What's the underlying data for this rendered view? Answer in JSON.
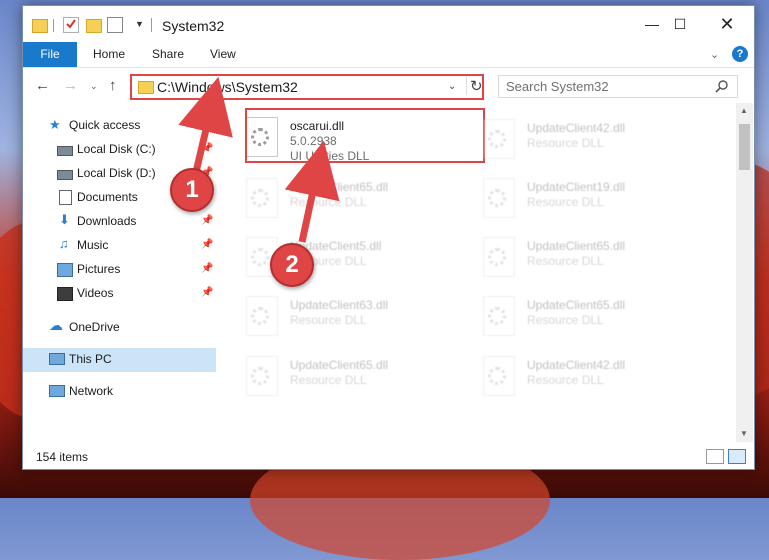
{
  "window": {
    "title": "System32"
  },
  "ribbon": {
    "tabs": [
      "File",
      "Home",
      "Share",
      "View"
    ]
  },
  "address": {
    "path": "C:\\Windows\\System32",
    "search_placeholder": "Search System32"
  },
  "nav": {
    "items": [
      {
        "label": "Quick access",
        "icon": "star-icon",
        "pinned": false
      },
      {
        "label": "Local Disk (C:)",
        "icon": "drive-icon",
        "pinned": true
      },
      {
        "label": "Local Disk (D:)",
        "icon": "drive-icon",
        "pinned": true
      },
      {
        "label": "Documents",
        "icon": "documents-icon",
        "pinned": true
      },
      {
        "label": "Downloads",
        "icon": "download-icon",
        "pinned": true
      },
      {
        "label": "Music",
        "icon": "music-icon",
        "pinned": true
      },
      {
        "label": "Pictures",
        "icon": "pictures-icon",
        "pinned": true
      },
      {
        "label": "Videos",
        "icon": "videos-icon",
        "pinned": true
      },
      {
        "label": "OneDrive",
        "icon": "cloud-icon",
        "pinned": false
      },
      {
        "label": "This PC",
        "icon": "computer-icon",
        "pinned": false,
        "selected": true
      },
      {
        "label": "Network",
        "icon": "network-icon",
        "pinned": false
      }
    ]
  },
  "files": {
    "highlighted": {
      "name": "oscarui.dll",
      "version": "5.0.2938",
      "description": "UI Utilities DLL"
    },
    "faded": [
      {
        "name": "UpdateClient42.dll",
        "description": "Resource DLL"
      },
      {
        "name": "UpdateClient65.dll",
        "description": "Resource DLL"
      },
      {
        "name": "UpdateClient19.dll",
        "description": "Resource DLL"
      },
      {
        "name": "UpdateClient5.dll",
        "description": "Resource DLL"
      },
      {
        "name": "UpdateClient65.dll",
        "description": "Resource DLL"
      },
      {
        "name": "UpdateClient63.dll",
        "description": "Resource DLL"
      },
      {
        "name": "UpdateClient65.dll",
        "description": "Resource DLL"
      },
      {
        "name": "UpdateClient65.dll",
        "description": "Resource DLL"
      },
      {
        "name": "UpdateClient42.dll",
        "description": "Resource DLL"
      }
    ]
  },
  "status": {
    "item_count": "154 items"
  },
  "callouts": [
    "1",
    "2"
  ],
  "colors": {
    "accent": "#1979ca",
    "highlight": "#e04545",
    "selected_nav": "#cce4f7"
  }
}
